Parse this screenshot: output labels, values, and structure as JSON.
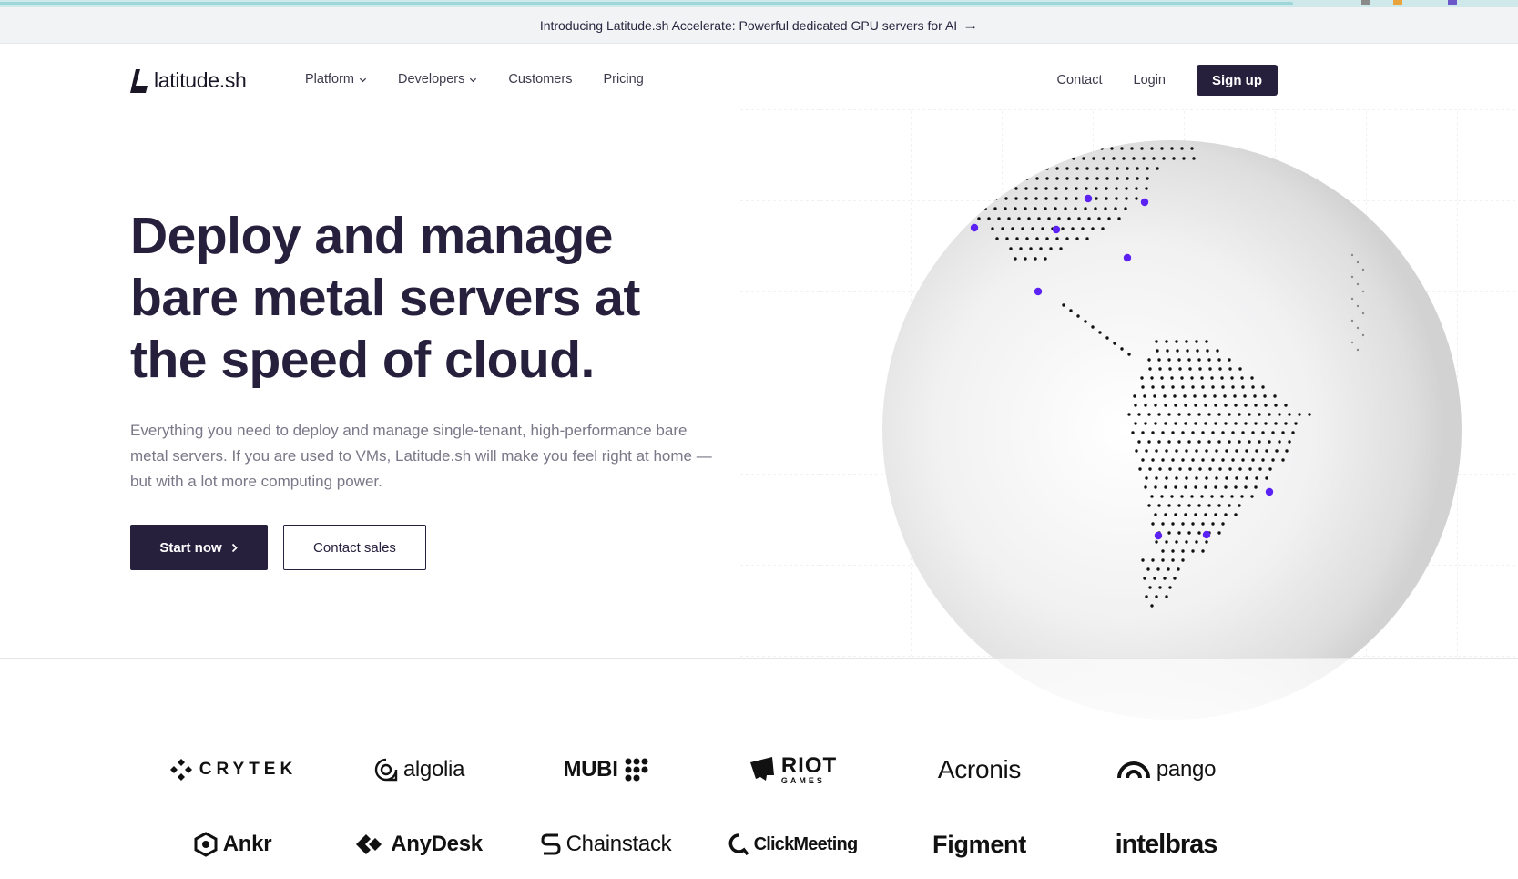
{
  "colors": {
    "brand_dark": "#27203d",
    "accent_purple": "#5b21f5",
    "dots": "#111111"
  },
  "announcement": {
    "text": "Introducing Latitude.sh Accelerate: Powerful dedicated GPU servers for AI",
    "icon": "arrow-right-icon"
  },
  "nav": {
    "logo_text": "latitude.sh",
    "items": [
      {
        "label": "Platform",
        "has_dropdown": true
      },
      {
        "label": "Developers",
        "has_dropdown": true
      },
      {
        "label": "Customers",
        "has_dropdown": false
      },
      {
        "label": "Pricing",
        "has_dropdown": false
      }
    ],
    "contact": "Contact",
    "login": "Login",
    "signup": "Sign up"
  },
  "hero": {
    "title_lines": [
      "Deploy and manage",
      "bare metal servers at",
      "the speed of cloud."
    ],
    "description": "Everything you need to deploy and manage single-tenant, high-performance bare metal servers. If you are used to VMs, Latitude.sh will make you feel right at home — but with a lot more computing power.",
    "start_now": "Start now",
    "contact_sales": "Contact sales"
  },
  "customers": {
    "row1": [
      {
        "name": "CRYTEK",
        "icon": "crytek-logo-icon"
      },
      {
        "name": "algolia",
        "icon": "algolia-logo-icon"
      },
      {
        "name": "MUBI",
        "icon": "mubi-logo-icon"
      },
      {
        "name": "RIOT",
        "sub": "GAMES",
        "icon": "riot-logo-icon"
      },
      {
        "name": "Acronis",
        "icon": ""
      },
      {
        "name": "pango",
        "icon": "pango-logo-icon"
      }
    ],
    "row2": [
      {
        "name": "Ankr",
        "icon": "ankr-logo-icon"
      },
      {
        "name": "AnyDesk",
        "icon": "anydesk-logo-icon"
      },
      {
        "name": "Chainstack",
        "icon": "chainstack-logo-icon"
      },
      {
        "name": "ClickMeeting",
        "icon": "clickmeeting-logo-icon"
      },
      {
        "name": "Figment",
        "icon": ""
      },
      {
        "name": "intelbras",
        "icon": ""
      }
    ]
  }
}
